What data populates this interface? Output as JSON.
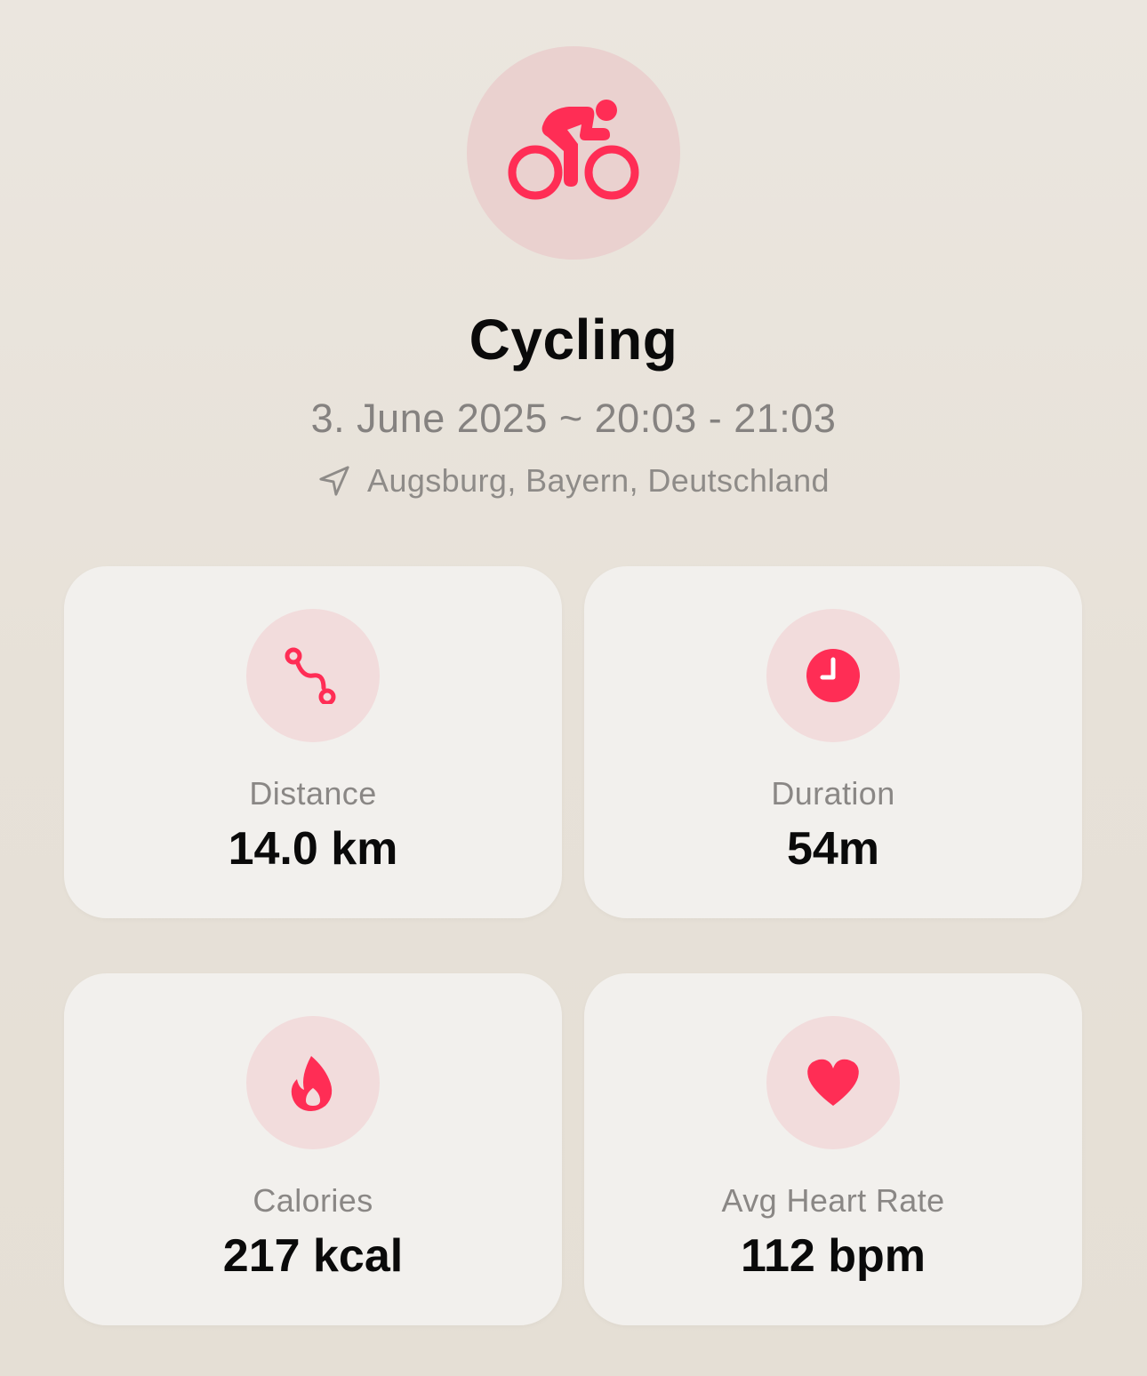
{
  "workout": {
    "title": "Cycling",
    "datetime": "3. June 2025 ~ 20:03 - 21:03",
    "location": "Augsburg, Bayern, Deutschland",
    "icon": "cycling-icon"
  },
  "colors": {
    "accent": "#ff2d55",
    "hero_circle": "#ead1cf",
    "icon_circle": "#f2dcdc",
    "card_bg": "#f2f0ed",
    "label_gray": "#8a8785"
  },
  "stats": {
    "distance": {
      "label": "Distance",
      "value": "14.0 km",
      "icon": "route-icon"
    },
    "duration": {
      "label": "Duration",
      "value": "54m",
      "icon": "clock-icon"
    },
    "calories": {
      "label": "Calories",
      "value": "217 kcal",
      "icon": "flame-icon"
    },
    "heart_rate": {
      "label": "Avg Heart Rate",
      "value": "112 bpm",
      "icon": "heart-icon"
    }
  }
}
